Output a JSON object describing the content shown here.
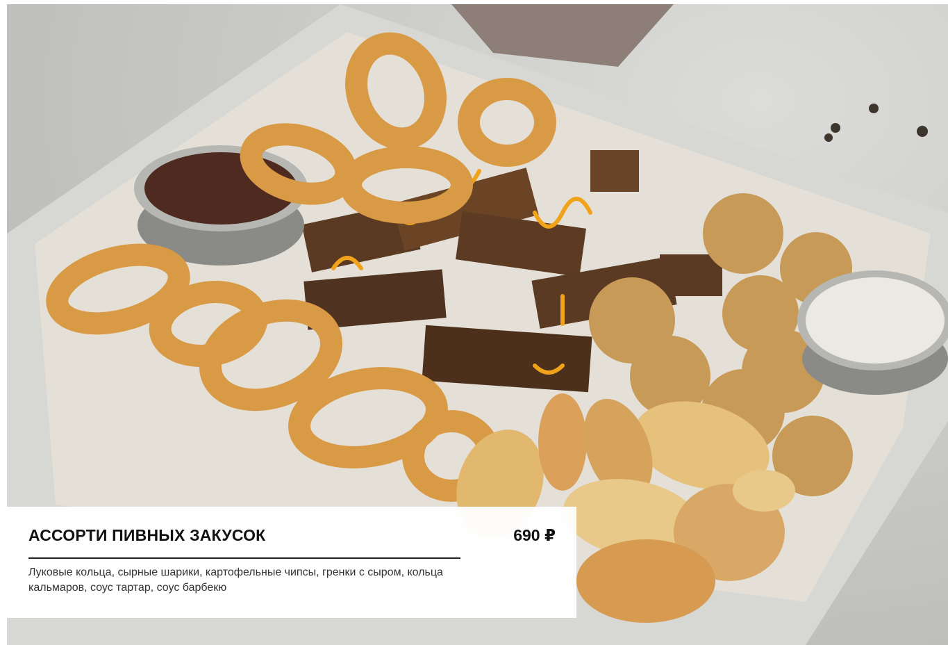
{
  "product": {
    "title": "АССОРТИ ПИВНЫХ ЗАКУСОК",
    "price": "690 ₽",
    "description": "Луковые кольца, сырные шарики, картофельные чипсы, гренки с сыром, кольца кальмаров, соус тартар, соус барбекю"
  },
  "photo": {
    "items": [
      "onion-rings",
      "squid-rings",
      "cheese-balls",
      "potato-chips",
      "croutons",
      "tartar-sauce",
      "bbq-sauce"
    ]
  }
}
